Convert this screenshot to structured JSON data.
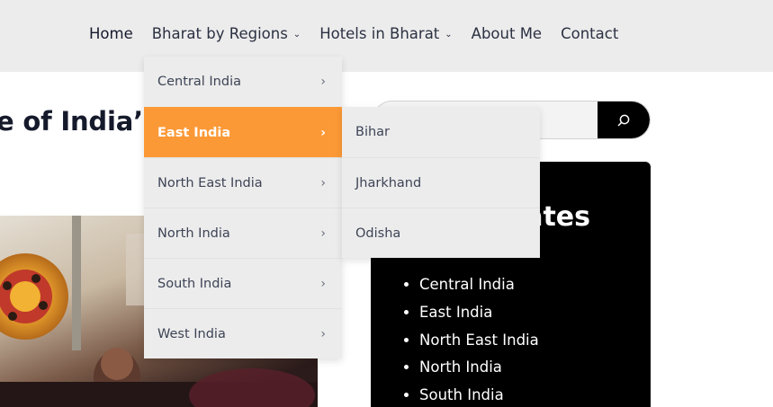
{
  "nav": {
    "items": [
      {
        "label": "Home",
        "has_dropdown": false
      },
      {
        "label": "Bharat by Regions",
        "has_dropdown": true
      },
      {
        "label": "Hotels in Bharat",
        "has_dropdown": true
      },
      {
        "label": "About Me",
        "has_dropdown": false
      },
      {
        "label": "Contact",
        "has_dropdown": false
      }
    ],
    "chevron": "⌄"
  },
  "page": {
    "heading_partial": "e of India’s"
  },
  "search": {
    "value": "",
    "button_icon": "search-icon"
  },
  "regions_dropdown": {
    "items": [
      {
        "label": "Central India"
      },
      {
        "label": "East India"
      },
      {
        "label": "North East India"
      },
      {
        "label": "North India"
      },
      {
        "label": "South India"
      },
      {
        "label": "West India"
      }
    ],
    "active_index": 1,
    "arrow": "›",
    "active_color": "#fc9937"
  },
  "submenu": {
    "items": [
      {
        "label": "Bihar"
      },
      {
        "label": "Jharkhand"
      },
      {
        "label": "Odisha"
      }
    ]
  },
  "states_panel": {
    "title_partial": "ates",
    "items": [
      {
        "label": "Central India"
      },
      {
        "label": "East India"
      },
      {
        "label": "North East India"
      },
      {
        "label": "North India"
      },
      {
        "label": "South India"
      }
    ]
  }
}
